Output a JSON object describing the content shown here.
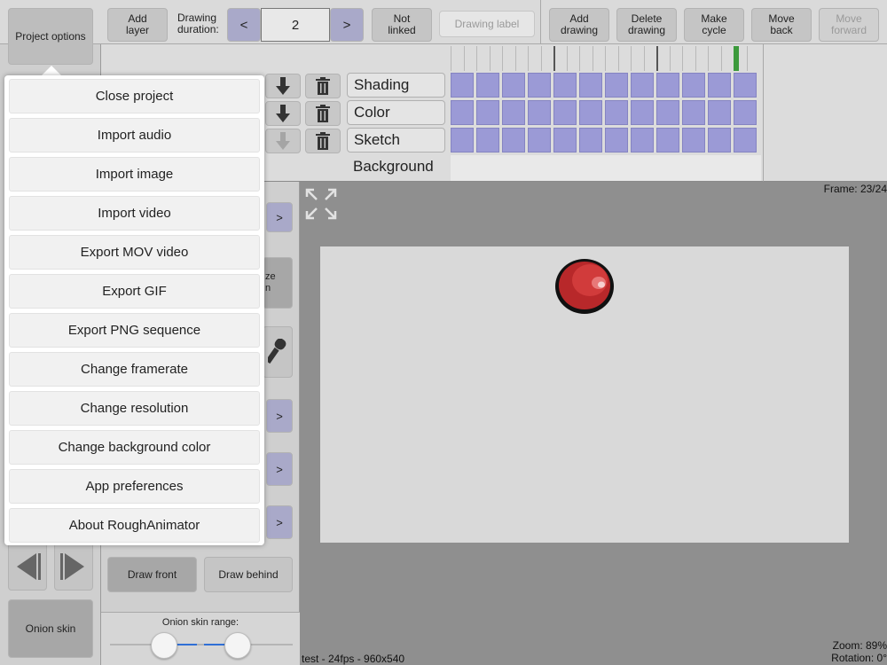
{
  "toolbar": {
    "project_options": "Project options",
    "add_layer": "Add\nlayer",
    "drawing_duration_label": "Drawing\nduration:",
    "duration_dec": "<",
    "duration_value": "2",
    "duration_inc": ">",
    "not_linked": "Not\nlinked",
    "drawing_label_placeholder": "Drawing label",
    "add_drawing": "Add\ndrawing",
    "delete_drawing": "Delete\ndrawing",
    "make_cycle": "Make\ncycle",
    "move_back": "Move\nback",
    "move_forward": "Move\nforward"
  },
  "layers": [
    {
      "name": "Shading"
    },
    {
      "name": "Color"
    },
    {
      "name": "Sketch"
    },
    {
      "name": "Background"
    }
  ],
  "menu": {
    "items": [
      "Close project",
      "Import audio",
      "Import image",
      "Import video",
      "Export MOV video",
      "Export GIF",
      "Export PNG sequence",
      "Change framerate",
      "Change resolution",
      "Change background color",
      "App preferences",
      "About RoughAnimator"
    ]
  },
  "tools": {
    "chevron": ">",
    "partial_label_1": "ze",
    "partial_label_2": "n",
    "draw_front": "Draw front",
    "draw_behind": "Draw behind",
    "onion_skin": "Onion skin",
    "onion_range_label": "Onion skin range:"
  },
  "status": {
    "frame": "Frame: 23/24",
    "project_info": "test - 24fps - 960x540",
    "zoom": "Zoom: 89%",
    "rotation": "Rotation: 0°"
  },
  "colors": {
    "frame_cell": "#9b9ad6",
    "playhead": "#3c9a3c",
    "ball": "#b8282a"
  }
}
